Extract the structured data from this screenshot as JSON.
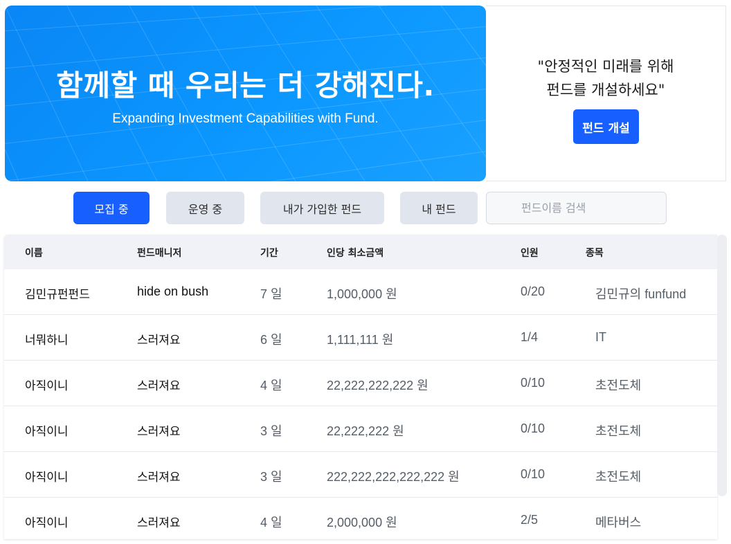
{
  "banner": {
    "title": "함께할 때 우리는 더 강해진다.",
    "subtitle": "Expanding Investment Capabilities with Fund."
  },
  "promo": {
    "quote_line1": "\"안정적인 미래를 위해",
    "quote_line2": "펀드를 개설하세요\"",
    "button_label": "펀드 개설"
  },
  "tabs": [
    {
      "label": "모집 중",
      "active": true
    },
    {
      "label": "운영 중",
      "active": false
    },
    {
      "label": "내가 가입한 펀드",
      "active": false
    },
    {
      "label": "내 펀드",
      "active": false
    }
  ],
  "search": {
    "placeholder": "펀드이름 검색",
    "value": ""
  },
  "table": {
    "headers": [
      "이름",
      "펀드매니저",
      "기간",
      "인당 최소금액",
      "인원",
      "종목"
    ],
    "rows": [
      {
        "name": "김민규펀펀드",
        "manager": "hide on bush",
        "period": "7 일",
        "min_amount": "1,000,000 원",
        "members": "0/20",
        "sector": "김민규의 funfund"
      },
      {
        "name": "너뭐하니",
        "manager": "스러져요",
        "period": "6 일",
        "min_amount": "1,111,111 원",
        "members": "1/4",
        "sector": "IT"
      },
      {
        "name": "아직이니",
        "manager": "스러져요",
        "period": "4 일",
        "min_amount": "22,222,222,222 원",
        "members": "0/10",
        "sector": "초전도체"
      },
      {
        "name": "아직이니",
        "manager": "스러져요",
        "period": "3 일",
        "min_amount": "22,222,222 원",
        "members": "0/10",
        "sector": "초전도체"
      },
      {
        "name": "아직이니",
        "manager": "스러져요",
        "period": "3 일",
        "min_amount": "222,222,222,222,222 원",
        "members": "0/10",
        "sector": "초전도체"
      },
      {
        "name": "아직이니",
        "manager": "스러져요",
        "period": "4 일",
        "min_amount": "2,000,000 원",
        "members": "2/5",
        "sector": "메타버스"
      }
    ]
  },
  "colors": {
    "accent": "#1760ff",
    "banner_blue": "#0b97ff",
    "tab_inactive": "#e1e5ee",
    "header_bg": "#f1f2f7"
  }
}
